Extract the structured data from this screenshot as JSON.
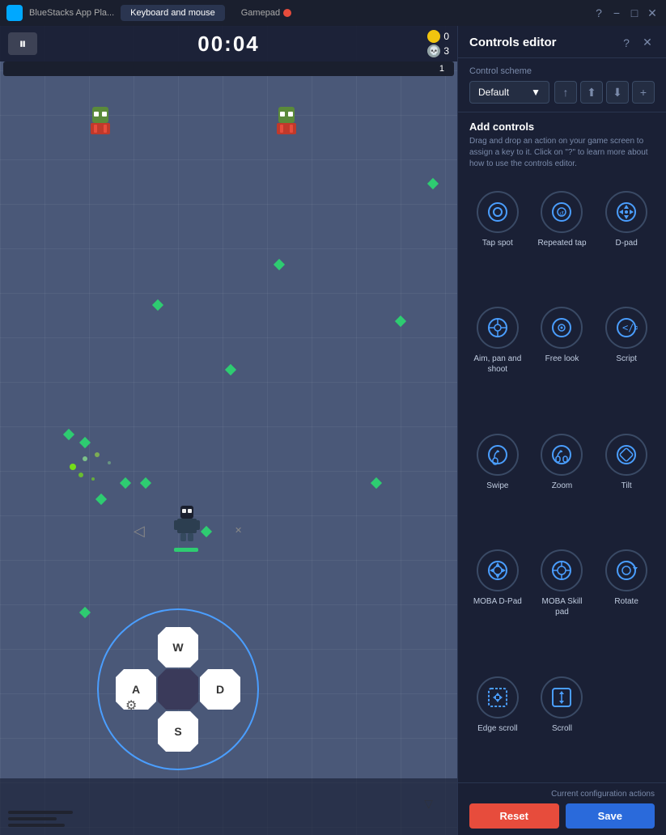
{
  "titleBar": {
    "appIcon": "bluestacks-icon",
    "appTitle": "BlueStacks App Pla...",
    "tabKeyboard": "Keyboard and mouse",
    "tabGamepad": "Gamepad",
    "helpBtn": "?",
    "minimizeBtn": "−",
    "maximizeBtn": "□",
    "closeBtn": "✕"
  },
  "game": {
    "timer": "00:04",
    "pauseBtn": "⏸",
    "score1": "0",
    "score2": "3",
    "healthLabel": "1"
  },
  "controlsPanel": {
    "title": "Controls editor",
    "helpIcon": "?",
    "closeIcon": "✕",
    "controlSchemeLabel": "Control scheme",
    "schemeDefault": "Default",
    "schemeChevron": "▼",
    "addControlsTitle": "Add controls",
    "addControlsDesc": "Drag and drop an action on your game screen to assign a key to it. Click on \"?\" to learn more about how to use the controls editor.",
    "controls": [
      {
        "id": "tap-spot",
        "label": "Tap spot",
        "iconType": "tap"
      },
      {
        "id": "repeated-tap",
        "label": "Repeated tap",
        "iconType": "repeated-tap"
      },
      {
        "id": "d-pad",
        "label": "D-pad",
        "iconType": "dpad"
      },
      {
        "id": "aim-pan-shoot",
        "label": "Aim, pan and shoot",
        "iconType": "aim"
      },
      {
        "id": "free-look",
        "label": "Free look",
        "iconType": "freelook"
      },
      {
        "id": "script",
        "label": "Script",
        "iconType": "script"
      },
      {
        "id": "swipe",
        "label": "Swipe",
        "iconType": "swipe"
      },
      {
        "id": "zoom",
        "label": "Zoom",
        "iconType": "zoom"
      },
      {
        "id": "tilt",
        "label": "Tilt",
        "iconType": "tilt"
      },
      {
        "id": "moba-dpad",
        "label": "MOBA D-Pad",
        "iconType": "moba-dpad"
      },
      {
        "id": "moba-skillpad",
        "label": "MOBA Skill pad",
        "iconType": "moba-skill"
      },
      {
        "id": "rotate",
        "label": "Rotate",
        "iconType": "rotate"
      },
      {
        "id": "edge-scroll",
        "label": "Edge scroll",
        "iconType": "edge-scroll"
      },
      {
        "id": "scroll",
        "label": "Scroll",
        "iconType": "scroll"
      }
    ],
    "currentConfigLabel": "Current configuration actions",
    "resetLabel": "Reset",
    "saveLabel": "Save"
  },
  "dpad": {
    "up": "W",
    "left": "A",
    "right": "D",
    "down": "S"
  }
}
